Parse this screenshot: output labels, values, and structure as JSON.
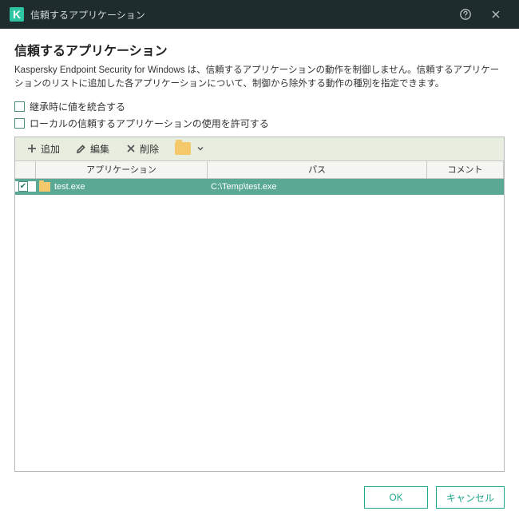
{
  "titlebar": {
    "title": "信頼するアプリケーション"
  },
  "heading": "信頼するアプリケーション",
  "description": "Kaspersky Endpoint Security for Windows は、信頼するアプリケーションの動作を制御しません。信頼するアプリケーションのリストに追加した各アプリケーションについて、制御から除外する動作の種別を指定できます。",
  "checkboxes": {
    "inherit": {
      "label": "継承時に値を統合する",
      "checked": false
    },
    "allow_local": {
      "label": "ローカルの信頼するアプリケーションの使用を許可する",
      "checked": false
    }
  },
  "toolbar": {
    "add": "追加",
    "edit": "編集",
    "delete": "削除"
  },
  "columns": {
    "application": "アプリケーション",
    "path": "パス",
    "comment": "コメント"
  },
  "rows": [
    {
      "checked": true,
      "app": "test.exe",
      "path": "C:\\Temp\\test.exe",
      "comment": ""
    }
  ],
  "footer": {
    "ok": "OK",
    "cancel": "キャンセル"
  }
}
